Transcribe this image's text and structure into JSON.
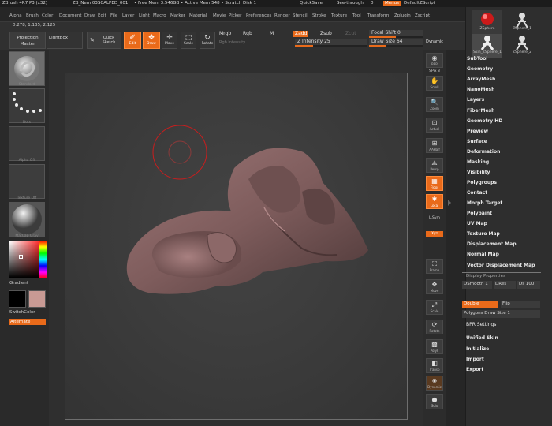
{
  "title_bar": {
    "app": "ZBrush 4R7 P3 (x32)",
    "document": "ZB_Nem 03SCALPED_001",
    "memory": "• Free Mem 3.546GB • Active Mem 548 • Scratch Disk 1",
    "quicksave": "QuickSave",
    "see_through_label": "See-through",
    "see_through_value": "0",
    "menus_button": "Menus",
    "default_zscript": "DefaultZScript"
  },
  "menu_bar": [
    "Alpha",
    "Brush",
    "Color",
    "Document",
    "Draw",
    "Edit",
    "File",
    "Layer",
    "Light",
    "Macro",
    "Marker",
    "Material",
    "Movie",
    "Picker",
    "Preferences",
    "Render",
    "Stencil",
    "Stroke",
    "Texture",
    "Tool",
    "Transform",
    "Zplugin",
    "Zscript"
  ],
  "coords": "0.278, 1.135, 2.125",
  "toolbar": {
    "projection_master": "Projection Master",
    "lightbox": "LightBox",
    "quick_sketch": "Quick Sketch",
    "edit": "Edit",
    "draw": "Draw",
    "move": "Move",
    "scale": "Scale",
    "rotate": "Rotate",
    "mrgb": "Mrgb",
    "rgb": "Rgb",
    "m": "M",
    "rgb_intensity": "Rgb Intensity",
    "zadd": "Zadd",
    "zsub": "Zsub",
    "zcut": "Zcut",
    "z_intensity_label": "Z Intensity",
    "z_intensity_value": "25",
    "z_intensity_pct": 0.25,
    "focal_shift_label": "Focal Shift",
    "focal_shift_value": "0",
    "focal_shift_pct": 0.5,
    "draw_size_label": "Draw Size",
    "draw_size_value": "64",
    "draw_size_pct": 0.32,
    "dynamic": "Dynamic"
  },
  "left_shelf": {
    "brush_label": "Standard",
    "stroke_label": "Dots",
    "alpha_label": "Alpha Off",
    "texture_label": "Texture Off",
    "material_label": "MatCap Gray",
    "gradient_label": "Gradient",
    "switch_color": "SwitchColor",
    "alternate": "Alternate",
    "colors": {
      "main": "#c89a94",
      "secondary": "#000000"
    }
  },
  "right_shelf": [
    {
      "label": "BPR",
      "icon": "bpr-icon",
      "active": false
    },
    {
      "label": "SPix 3",
      "icon": "spix-icon",
      "active": false
    },
    {
      "label": "Scroll",
      "icon": "scroll-icon",
      "active": false
    },
    {
      "label": "Zoom",
      "icon": "zoom-icon",
      "active": false
    },
    {
      "label": "Actual",
      "icon": "actual-icon",
      "active": false
    },
    {
      "label": "AAHalf",
      "icon": "aahalf-icon",
      "active": false
    },
    {
      "label": "Persp",
      "icon": "persp-icon",
      "active": false
    },
    {
      "label": "Floor",
      "icon": "floor-icon",
      "active": true
    },
    {
      "label": "Local",
      "icon": "local-icon",
      "active": true
    },
    {
      "label": "L.Sym",
      "icon": "lsym-icon",
      "active": false
    },
    {
      "label": "Xyz",
      "icon": "xyz-icon",
      "active": true
    },
    {
      "label": "Frame",
      "icon": "frame-icon",
      "active": false
    },
    {
      "label": "Move",
      "icon": "move-icon",
      "active": false
    },
    {
      "label": "Scale",
      "icon": "scale-icon",
      "active": false
    },
    {
      "label": "Rotate",
      "icon": "rotate-icon",
      "active": false
    },
    {
      "label": "PolyF",
      "icon": "polyf-icon",
      "active": false
    },
    {
      "label": "Transp",
      "icon": "transp-icon",
      "active": false
    },
    {
      "label": "Dynamic",
      "icon": "dynamic-icon",
      "active": false
    },
    {
      "label": "Solo",
      "icon": "solo-icon",
      "active": false
    }
  ],
  "palette": {
    "tools": [
      {
        "label": "ZSphere"
      },
      {
        "label": "ZSphere_1"
      },
      {
        "label": "Skin_ZSphere_1"
      },
      {
        "label": "ZSphere_2"
      }
    ],
    "menu_items": [
      "SubTool",
      "Geometry",
      "ArrayMesh",
      "NanoMesh",
      "Layers",
      "FiberMesh",
      "Geometry HD",
      "Preview",
      "Surface",
      "Deformation",
      "Masking",
      "Visibility",
      "Polygroups",
      "Contact",
      "Morph Target",
      "Polypaint",
      "UV Map",
      "Texture Map",
      "Displacement Map",
      "Normal Map",
      "Vector Displacement Map"
    ],
    "display_properties": {
      "title": "Display Properties",
      "dsmooth_label": "DSmooth",
      "dsmooth_value": "1",
      "dres_label": "DRes",
      "ds_label": "Ds",
      "ds_value": "100",
      "double": "Double",
      "flip": "Flip",
      "polygons_draw_size_label": "Polygons Draw Size",
      "polygons_draw_size_value": "1"
    },
    "bottom_items": [
      "BPR Settings",
      "Unified Skin",
      "Initialize",
      "Import",
      "Export"
    ]
  },
  "colors": {
    "accent": "#e96a1a",
    "mesh": "#8a6464",
    "brush_cursor": "#c81e1e"
  }
}
